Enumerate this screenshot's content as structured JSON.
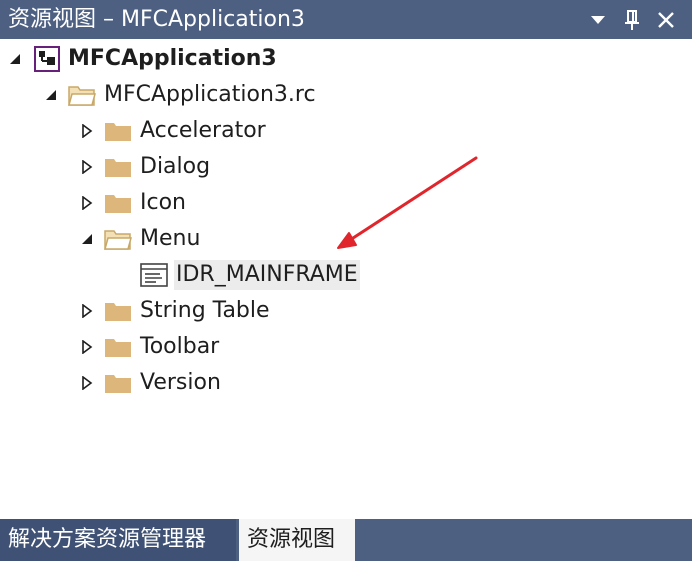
{
  "window": {
    "title": "资源视图 – MFCApplication3",
    "controls": {
      "dropdown_icon": "chevron-down",
      "pin_icon": "pin",
      "close_icon": "close"
    }
  },
  "tree": {
    "root": {
      "label": "MFCApplication3",
      "expanded": true
    },
    "rc_file": {
      "label": "MFCApplication3.rc",
      "expanded": true
    },
    "folders": [
      {
        "label": "Accelerator",
        "expanded": false
      },
      {
        "label": "Dialog",
        "expanded": false
      },
      {
        "label": "Icon",
        "expanded": false
      },
      {
        "label": "Menu",
        "expanded": true
      },
      {
        "label": "String Table",
        "expanded": false
      },
      {
        "label": "Toolbar",
        "expanded": false
      },
      {
        "label": "Version",
        "expanded": false
      }
    ],
    "menu_item": {
      "label": "IDR_MAINFRAME",
      "selected": true
    }
  },
  "tabs": [
    {
      "label": "解决方案资源管理器",
      "active": false
    },
    {
      "label": "资源视图",
      "active": true
    }
  ],
  "colors": {
    "titlebar": "#4d6082",
    "tab_inactive": "#3f5275",
    "tab_active": "#f5f5f5",
    "folder": "#dcb67a",
    "arrow": "#e0262c",
    "selection": "#ececec"
  }
}
